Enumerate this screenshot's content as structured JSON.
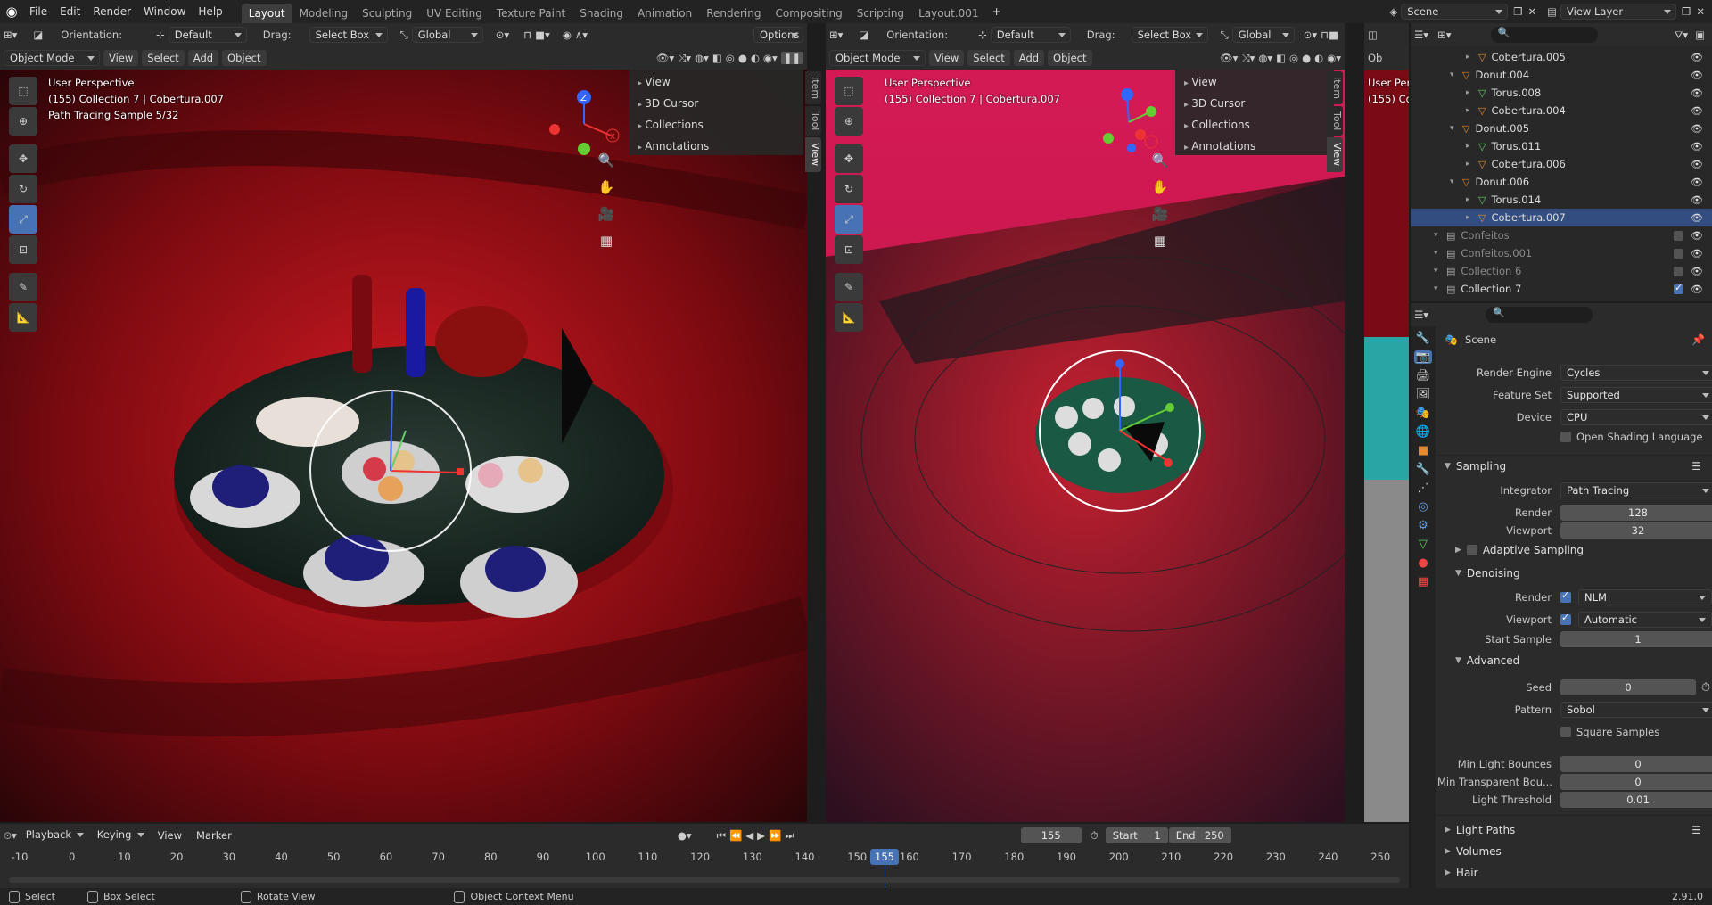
{
  "topbar": {
    "menus": [
      "File",
      "Edit",
      "Render",
      "Window",
      "Help"
    ],
    "workspaces": [
      "Layout",
      "Modeling",
      "Sculpting",
      "UV Editing",
      "Texture Paint",
      "Shading",
      "Animation",
      "Rendering",
      "Compositing",
      "Scripting",
      "Layout.001"
    ],
    "active_workspace": "Layout",
    "scene": "Scene",
    "view_layer": "View Layer"
  },
  "viewport_left": {
    "orientation_label": "Orientation:",
    "orientation": "Default",
    "drag_label": "Drag:",
    "drag": "Select Box",
    "transform": "Global",
    "options": "Options",
    "mode": "Object Mode",
    "menus": [
      "View",
      "Select",
      "Add",
      "Object"
    ],
    "overlay": [
      "User Perspective",
      "(155) Collection 7 | Cobertura.007",
      "Path Tracing Sample 5/32"
    ],
    "npanel": [
      "View",
      "3D Cursor",
      "Collections",
      "Annotations"
    ],
    "tabs": [
      "Item",
      "Tool",
      "View"
    ]
  },
  "viewport_right": {
    "orientation_label": "Orientation:",
    "orientation": "Default",
    "drag_label": "Drag:",
    "drag": "Select Box",
    "transform": "Global",
    "mode": "Object Mode",
    "menus": [
      "View",
      "Select",
      "Add",
      "Object"
    ],
    "overlay": [
      "User Perspective",
      "(155) Collection 7 | Cobertura.007"
    ],
    "npanel": [
      "View",
      "3D Cursor",
      "Collections",
      "Annotations"
    ],
    "tabs": [
      "Item",
      "Tool",
      "View"
    ]
  },
  "viewport_peek": {
    "overlay": [
      "User Persp",
      "(155) Co"
    ],
    "header": "Ob"
  },
  "outliner": {
    "items": [
      {
        "label": "Cobertura.005",
        "indent": 3,
        "type": "obj",
        "dim": false,
        "sel": false
      },
      {
        "label": "Donut.004",
        "indent": 2,
        "type": "empty",
        "dim": false,
        "sel": false
      },
      {
        "label": "Torus.008",
        "indent": 3,
        "type": "mesh",
        "dim": false,
        "sel": false
      },
      {
        "label": "Cobertura.004",
        "indent": 3,
        "type": "obj",
        "dim": false,
        "sel": false
      },
      {
        "label": "Donut.005",
        "indent": 2,
        "type": "empty",
        "dim": false,
        "sel": false
      },
      {
        "label": "Torus.011",
        "indent": 3,
        "type": "mesh",
        "dim": false,
        "sel": false
      },
      {
        "label": "Cobertura.006",
        "indent": 3,
        "type": "obj",
        "dim": false,
        "sel": false
      },
      {
        "label": "Donut.006",
        "indent": 2,
        "type": "empty",
        "dim": false,
        "sel": false
      },
      {
        "label": "Torus.014",
        "indent": 3,
        "type": "mesh",
        "dim": false,
        "sel": false
      },
      {
        "label": "Cobertura.007",
        "indent": 3,
        "type": "obj",
        "dim": false,
        "sel": true
      },
      {
        "label": "Confeitos",
        "indent": 1,
        "type": "coll",
        "dim": true,
        "sel": false
      },
      {
        "label": "Confeitos.001",
        "indent": 1,
        "type": "coll",
        "dim": true,
        "sel": false
      },
      {
        "label": "Collection 6",
        "indent": 1,
        "type": "coll",
        "dim": true,
        "sel": false
      },
      {
        "label": "Collection 7",
        "indent": 1,
        "type": "coll",
        "dim": false,
        "sel": false
      }
    ]
  },
  "properties": {
    "context": "Scene",
    "render_engine_label": "Render Engine",
    "render_engine": "Cycles",
    "feature_set_label": "Feature Set",
    "feature_set": "Supported",
    "device_label": "Device",
    "device": "CPU",
    "osl_label": "Open Shading Language",
    "sampling": "Sampling",
    "integrator_label": "Integrator",
    "integrator": "Path Tracing",
    "render_label": "Render",
    "render_samples": "128",
    "viewport_label": "Viewport",
    "viewport_samples": "32",
    "adaptive": "Adaptive Sampling",
    "denoising": "Denoising",
    "den_render_label": "Render",
    "den_render": "NLM",
    "den_viewport_label": "Viewport",
    "den_viewport": "Automatic",
    "start_sample_label": "Start Sample",
    "start_sample": "1",
    "advanced": "Advanced",
    "seed_label": "Seed",
    "seed": "0",
    "pattern_label": "Pattern",
    "pattern": "Sobol",
    "square_label": "Square Samples",
    "min_bounces_label": "Min Light Bounces",
    "min_bounces": "0",
    "min_transp_label": "Min Transparent Bou...",
    "min_transp": "0",
    "threshold_label": "Light Threshold",
    "threshold": "0.01",
    "light_paths": "Light Paths",
    "volumes": "Volumes",
    "hair": "Hair"
  },
  "timeline": {
    "menus": [
      "Playback",
      "Keying",
      "View",
      "Marker"
    ],
    "current_frame": "155",
    "start_label": "Start",
    "start": "1",
    "end_label": "End",
    "end": "250",
    "ticks": [
      "-10",
      "0",
      "10",
      "20",
      "30",
      "40",
      "50",
      "60",
      "70",
      "80",
      "90",
      "100",
      "110",
      "120",
      "130",
      "140",
      "150",
      "160",
      "170",
      "180",
      "190",
      "200",
      "210",
      "220",
      "230",
      "240",
      "250"
    ]
  },
  "statusbar": {
    "select": "Select",
    "box_select": "Box Select",
    "rotate": "Rotate View",
    "context": "Object Context Menu",
    "version": "2.91.0"
  }
}
